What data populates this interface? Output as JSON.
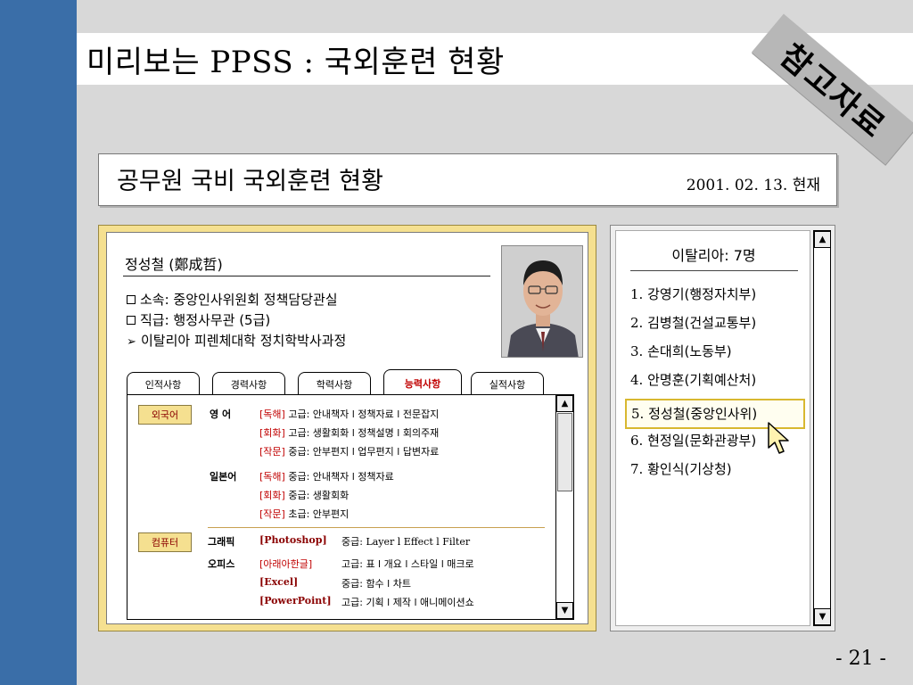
{
  "slide": {
    "title": "미리보는 PPSS : 국외훈련 현황",
    "stamp": "참고자료",
    "page_number": "- 21 -"
  },
  "banner": {
    "title": "공무원 국비 국외훈련 현황",
    "date": "2001. 02. 13. 현재"
  },
  "profile": {
    "name": "정성철 (鄭成哲)",
    "info": [
      {
        "bullet": "box",
        "text": "소속: 중앙인사위원회 정책담당관실"
      },
      {
        "bullet": "box",
        "text": "직급: 행정사무관 (5급)"
      },
      {
        "bullet": "arrow",
        "text": "이탈리아 피렌체대학 정치학박사과정"
      }
    ]
  },
  "tabs": [
    {
      "label": "인적사항",
      "active": false
    },
    {
      "label": "경력사항",
      "active": false
    },
    {
      "label": "학력사항",
      "active": false
    },
    {
      "label": "능력사항",
      "active": true
    },
    {
      "label": "실적사항",
      "active": false
    }
  ],
  "abilities": {
    "language_label": "외국어",
    "languages": [
      {
        "name": "영  어",
        "items": [
          {
            "tag": "[독해]",
            "text": " 고급: 안내책자 l 정책자료 l 전문잡지"
          },
          {
            "tag": "[회화]",
            "text": " 고급: 생활회화 l 정책설명 l 회의주재"
          },
          {
            "tag": "[작문]",
            "text": " 중급: 안부편지 l 업무편지 l 답변자료"
          }
        ]
      },
      {
        "name": "일본어",
        "items": [
          {
            "tag": "[독해]",
            "text": " 중급: 안내책자 l 정책자료"
          },
          {
            "tag": "[회화]",
            "text": " 중급: 생활회화"
          },
          {
            "tag": "[작문]",
            "text": " 초급: 안부편지"
          }
        ]
      }
    ],
    "computer_label": "컴퓨터",
    "computer": [
      {
        "name": "그래픽",
        "items": [
          {
            "tag": "[Photoshop]",
            "text": "중급: Layer l Effect l Filter"
          }
        ]
      },
      {
        "name": "오피스",
        "items": [
          {
            "tag": "[아래아한글]",
            "text": "고급: 표 l 개요 l 스타일 l 매크로"
          },
          {
            "tag": "[Excel]",
            "text": "중급: 함수 l 차트"
          },
          {
            "tag": "[PowerPoint]",
            "text": "고급: 기획 l 제작 l 애니메이션쇼"
          }
        ]
      }
    ]
  },
  "country_list": {
    "header": "이탈리아: 7명",
    "people": [
      {
        "num": "1.",
        "name": "강영기",
        "dept": "(행정자치부)"
      },
      {
        "num": "2.",
        "name": "김병철",
        "dept": "(건설교통부)"
      },
      {
        "num": "3.",
        "name": "손대희",
        "dept": "(노동부)"
      },
      {
        "num": "4.",
        "name": "안명훈",
        "dept": "(기획예산처)"
      },
      {
        "num": "5.",
        "name": "정성철",
        "dept": "(중앙인사위)",
        "selected": true
      },
      {
        "num": "6.",
        "name": "현정일",
        "dept": "(문화관광부)"
      },
      {
        "num": "7.",
        "name": "황인식",
        "dept": "(기상청)"
      }
    ]
  },
  "colors": {
    "left_bar": "#3a6ea8",
    "panel_gold": "#f5e090",
    "tag_red": "#c00000"
  }
}
